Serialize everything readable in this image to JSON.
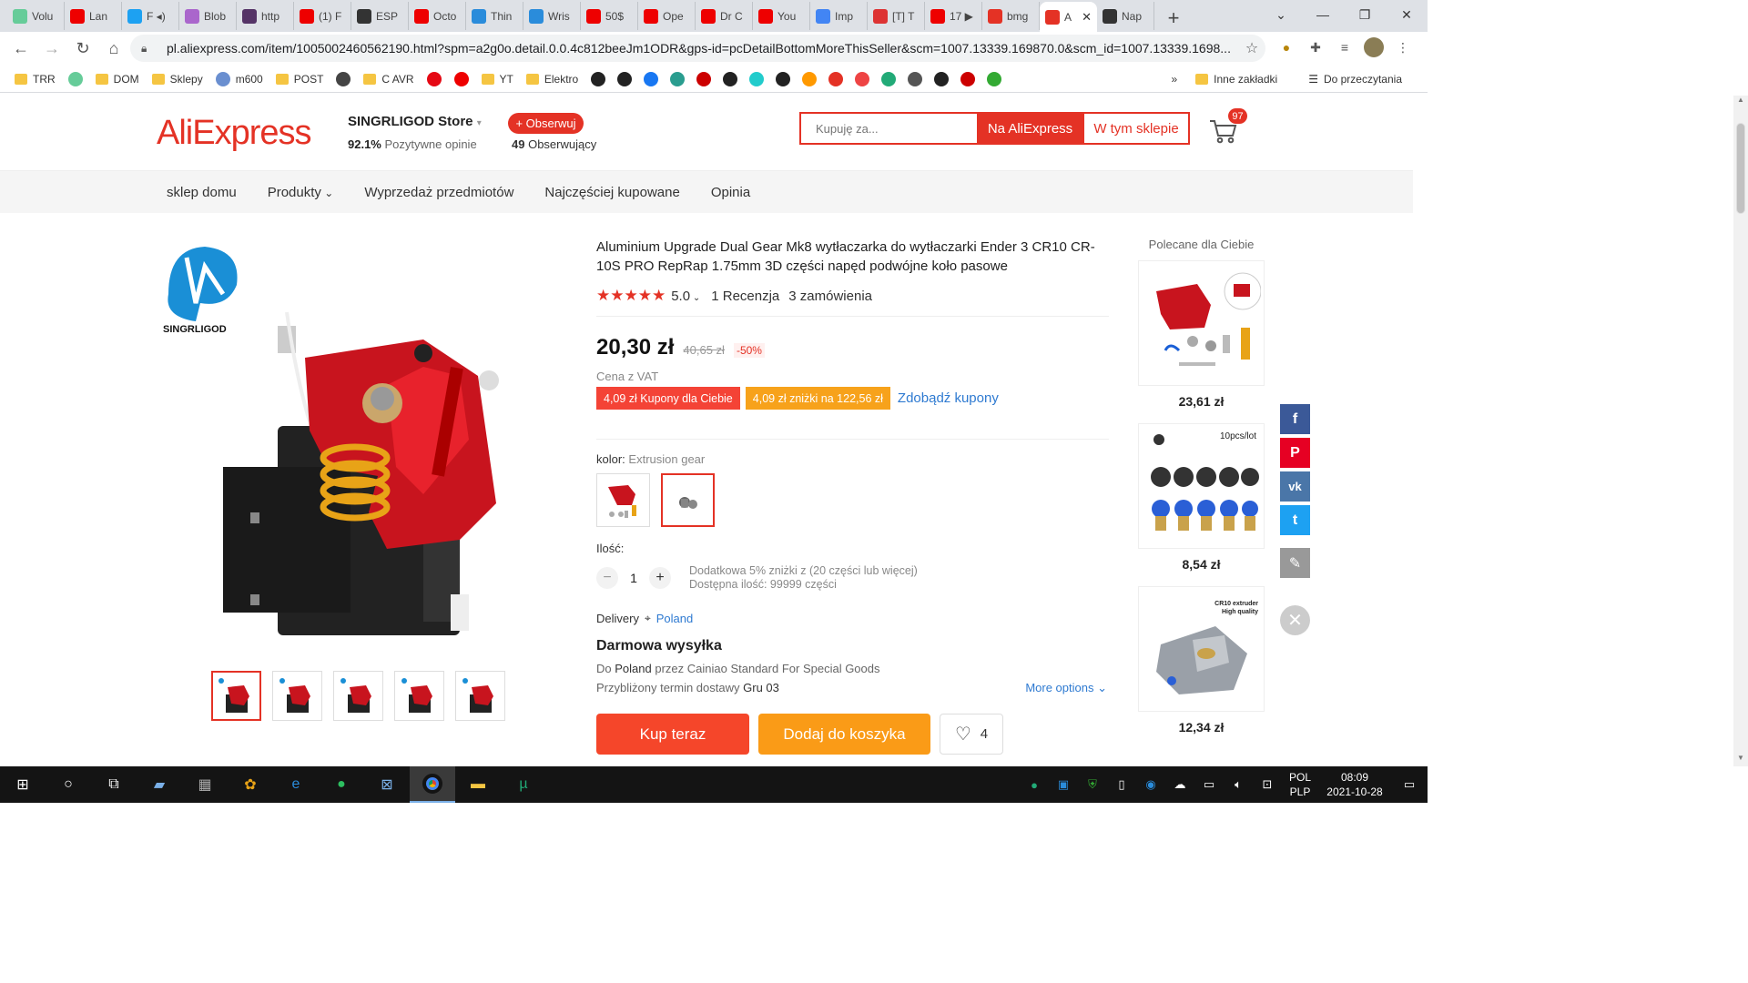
{
  "browser": {
    "tabs": [
      {
        "label": "Volu",
        "color": "#6c9"
      },
      {
        "label": "Lan",
        "color": "#e00"
      },
      {
        "label": "F ◂)",
        "color": "#1da1f2"
      },
      {
        "label": "Blob",
        "color": "#a6c"
      },
      {
        "label": "http",
        "color": "#536"
      },
      {
        "label": "(1) F",
        "color": "#e00"
      },
      {
        "label": "ESP",
        "color": "#333"
      },
      {
        "label": "Octo",
        "color": "#e00"
      },
      {
        "label": "Thin",
        "color": "#2a8cdb"
      },
      {
        "label": "Wris",
        "color": "#2a8cdb"
      },
      {
        "label": "50$",
        "color": "#e00"
      },
      {
        "label": "Ope",
        "color": "#e00"
      },
      {
        "label": "Dr C",
        "color": "#e00"
      },
      {
        "label": "You",
        "color": "#e00"
      },
      {
        "label": "Imp",
        "color": "#4285f4"
      },
      {
        "label": "[T] T",
        "color": "#d33"
      },
      {
        "label": "17 ▶",
        "color": "#e00"
      },
      {
        "label": "bmg",
        "color": "#e43225"
      },
      {
        "label": "A",
        "color": "#e43225"
      },
      {
        "label": "Nap",
        "color": "#333"
      }
    ],
    "active_tab_index": 18,
    "new_tab_symbol": "+",
    "url": "pl.aliexpress.com/item/1005002460562190.html?spm=a2g0o.detail.0.0.4c812beeJm1ODR&gps-id=pcDetailBottomMoreThisSeller&scm=1007.13339.169870.0&scm_id=1007.13339.1698...",
    "bookmarks": [
      {
        "label": "TRR",
        "type": "folder"
      },
      {
        "label": "",
        "type": "icon",
        "color": "#6c9"
      },
      {
        "label": "DOM",
        "type": "folder"
      },
      {
        "label": "Sklepy",
        "type": "folder"
      },
      {
        "label": "m600",
        "type": "icon",
        "color": "#6a8fd0"
      },
      {
        "label": "POST",
        "type": "folder"
      },
      {
        "label": "",
        "type": "icon",
        "color": "#444"
      },
      {
        "label": "C AVR",
        "type": "folder"
      },
      {
        "label": "",
        "type": "icon",
        "color": "#e50914"
      },
      {
        "label": "",
        "type": "icon",
        "color": "#e00"
      },
      {
        "label": "YT",
        "type": "folder"
      },
      {
        "label": "Elektro",
        "type": "folder"
      }
    ],
    "bookmark_icon_colors": [
      "#222",
      "#222",
      "#1877f2",
      "#2a9d8f",
      "#c00",
      "#222",
      "#2cc",
      "#222",
      "#f90",
      "#e43225",
      "#e44",
      "#2a7",
      "#555",
      "#222",
      "#c00",
      "#3a3"
    ],
    "bookmarks_overflow": "»",
    "other_bookmarks": "Inne zakładki",
    "reading_list": "Do przeczytania"
  },
  "store": {
    "logo": "AliExpress",
    "name": "SINGRLIGOD Store",
    "positive_pct": "92.1%",
    "positive_label": "Pozytywne opinie",
    "follow_label": "+ Obserwuj",
    "followers_count": "49",
    "followers_label": "Obserwujący",
    "search_placeholder": "Kupuję za...",
    "search_ali_label": "Na AliExpress",
    "search_store_label": "W tym sklepie",
    "cart_count": "97",
    "nav": [
      "sklep domu",
      "Produkty",
      "Wyprzedaż przedmiotów",
      "Najczęściej kupowane",
      "Opinia"
    ]
  },
  "product": {
    "image_logo_text": "SINGRLIGOD",
    "title": "Aluminium Upgrade Dual Gear Mk8 wytłaczarka do wytłaczarki Ender 3 CR10 CR-10S PRO RepRap 1.75mm 3D części napęd podwójne koło pasowe",
    "rating": "5.0",
    "rating_value": 5,
    "reviews": "1 Recenzja",
    "orders": "3 zamówienia",
    "price": "20,30 zł",
    "old_price": "40,65 zł",
    "discount": "-50%",
    "vat_label": "Cena z VAT",
    "coupon1": "4,09 zł Kupony dla Ciebie",
    "coupon2": "4,09 zł zniżki na 122,56 zł",
    "get_coupons": "Zdobądź kupony",
    "color_label": "kolor:",
    "color_value": "Extrusion gear",
    "quantity_label": "Ilość:",
    "quantity": "1",
    "qty_note1": "Dodatkowa 5% zniżki z (20 części lub więcej)",
    "qty_note2": "Dostępna ilość: 99999 części",
    "delivery_label": "Delivery",
    "delivery_country": "Poland",
    "free_shipping": "Darmowa wysyłka",
    "ship_to_prefix": "Do",
    "ship_to_country": "Poland",
    "ship_via_text": "przez Cainiao Standard For Special Goods",
    "eta_prefix": "Przybliżony termin dostawy",
    "eta_date": "Gru 03",
    "more_options": "More options",
    "buy_now": "Kup teraz",
    "add_to_cart": "Dodaj do koszyka",
    "wishlist_count": "4"
  },
  "recommended": {
    "title": "Polecane dla Ciebie",
    "items": [
      {
        "price": "23,61 zł",
        "caption": ""
      },
      {
        "price": "8,54 zł",
        "caption": "10pcs/lot"
      },
      {
        "price": "12,34 zł",
        "caption": "CR10 extruder High quality"
      }
    ]
  },
  "share": [
    "f",
    "P",
    "vk",
    "t",
    "✎"
  ],
  "taskbar": {
    "lang_top": "POL",
    "lang_bottom": "PLP",
    "time": "08:09",
    "date": "2021-10-28"
  }
}
